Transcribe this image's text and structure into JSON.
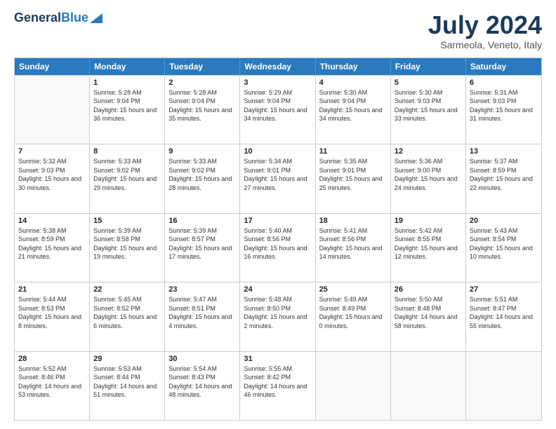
{
  "header": {
    "logo_general": "General",
    "logo_blue": "Blue",
    "month_title": "July 2024",
    "location": "Sarmeola, Veneto, Italy"
  },
  "days_of_week": [
    "Sunday",
    "Monday",
    "Tuesday",
    "Wednesday",
    "Thursday",
    "Friday",
    "Saturday"
  ],
  "weeks": [
    [
      {
        "day": "",
        "empty": true
      },
      {
        "day": "1",
        "sunrise": "5:28 AM",
        "sunset": "9:04 PM",
        "daylight": "15 hours and 36 minutes."
      },
      {
        "day": "2",
        "sunrise": "5:28 AM",
        "sunset": "9:04 PM",
        "daylight": "15 hours and 35 minutes."
      },
      {
        "day": "3",
        "sunrise": "5:29 AM",
        "sunset": "9:04 PM",
        "daylight": "15 hours and 34 minutes."
      },
      {
        "day": "4",
        "sunrise": "5:30 AM",
        "sunset": "9:04 PM",
        "daylight": "15 hours and 34 minutes."
      },
      {
        "day": "5",
        "sunrise": "5:30 AM",
        "sunset": "9:03 PM",
        "daylight": "15 hours and 33 minutes."
      },
      {
        "day": "6",
        "sunrise": "5:31 AM",
        "sunset": "9:03 PM",
        "daylight": "15 hours and 31 minutes."
      }
    ],
    [
      {
        "day": "7",
        "sunrise": "5:32 AM",
        "sunset": "9:03 PM",
        "daylight": "15 hours and 30 minutes."
      },
      {
        "day": "8",
        "sunrise": "5:33 AM",
        "sunset": "9:02 PM",
        "daylight": "15 hours and 29 minutes."
      },
      {
        "day": "9",
        "sunrise": "5:33 AM",
        "sunset": "9:02 PM",
        "daylight": "15 hours and 28 minutes."
      },
      {
        "day": "10",
        "sunrise": "5:34 AM",
        "sunset": "9:01 PM",
        "daylight": "15 hours and 27 minutes."
      },
      {
        "day": "11",
        "sunrise": "5:35 AM",
        "sunset": "9:01 PM",
        "daylight": "15 hours and 25 minutes."
      },
      {
        "day": "12",
        "sunrise": "5:36 AM",
        "sunset": "9:00 PM",
        "daylight": "15 hours and 24 minutes."
      },
      {
        "day": "13",
        "sunrise": "5:37 AM",
        "sunset": "8:59 PM",
        "daylight": "15 hours and 22 minutes."
      }
    ],
    [
      {
        "day": "14",
        "sunrise": "5:38 AM",
        "sunset": "8:59 PM",
        "daylight": "15 hours and 21 minutes."
      },
      {
        "day": "15",
        "sunrise": "5:39 AM",
        "sunset": "8:58 PM",
        "daylight": "15 hours and 19 minutes."
      },
      {
        "day": "16",
        "sunrise": "5:39 AM",
        "sunset": "8:57 PM",
        "daylight": "15 hours and 17 minutes."
      },
      {
        "day": "17",
        "sunrise": "5:40 AM",
        "sunset": "8:56 PM",
        "daylight": "15 hours and 16 minutes."
      },
      {
        "day": "18",
        "sunrise": "5:41 AM",
        "sunset": "8:56 PM",
        "daylight": "15 hours and 14 minutes."
      },
      {
        "day": "19",
        "sunrise": "5:42 AM",
        "sunset": "8:55 PM",
        "daylight": "15 hours and 12 minutes."
      },
      {
        "day": "20",
        "sunrise": "5:43 AM",
        "sunset": "8:54 PM",
        "daylight": "15 hours and 10 minutes."
      }
    ],
    [
      {
        "day": "21",
        "sunrise": "5:44 AM",
        "sunset": "8:53 PM",
        "daylight": "15 hours and 8 minutes."
      },
      {
        "day": "22",
        "sunrise": "5:45 AM",
        "sunset": "8:52 PM",
        "daylight": "15 hours and 6 minutes."
      },
      {
        "day": "23",
        "sunrise": "5:47 AM",
        "sunset": "8:51 PM",
        "daylight": "15 hours and 4 minutes."
      },
      {
        "day": "24",
        "sunrise": "5:48 AM",
        "sunset": "8:50 PM",
        "daylight": "15 hours and 2 minutes."
      },
      {
        "day": "25",
        "sunrise": "5:49 AM",
        "sunset": "8:49 PM",
        "daylight": "15 hours and 0 minutes."
      },
      {
        "day": "26",
        "sunrise": "5:50 AM",
        "sunset": "8:48 PM",
        "daylight": "14 hours and 58 minutes."
      },
      {
        "day": "27",
        "sunrise": "5:51 AM",
        "sunset": "8:47 PM",
        "daylight": "14 hours and 55 minutes."
      }
    ],
    [
      {
        "day": "28",
        "sunrise": "5:52 AM",
        "sunset": "8:46 PM",
        "daylight": "14 hours and 53 minutes."
      },
      {
        "day": "29",
        "sunrise": "5:53 AM",
        "sunset": "8:44 PM",
        "daylight": "14 hours and 51 minutes."
      },
      {
        "day": "30",
        "sunrise": "5:54 AM",
        "sunset": "8:43 PM",
        "daylight": "14 hours and 48 minutes."
      },
      {
        "day": "31",
        "sunrise": "5:55 AM",
        "sunset": "8:42 PM",
        "daylight": "14 hours and 46 minutes."
      },
      {
        "day": "",
        "empty": true
      },
      {
        "day": "",
        "empty": true
      },
      {
        "day": "",
        "empty": true
      }
    ]
  ]
}
